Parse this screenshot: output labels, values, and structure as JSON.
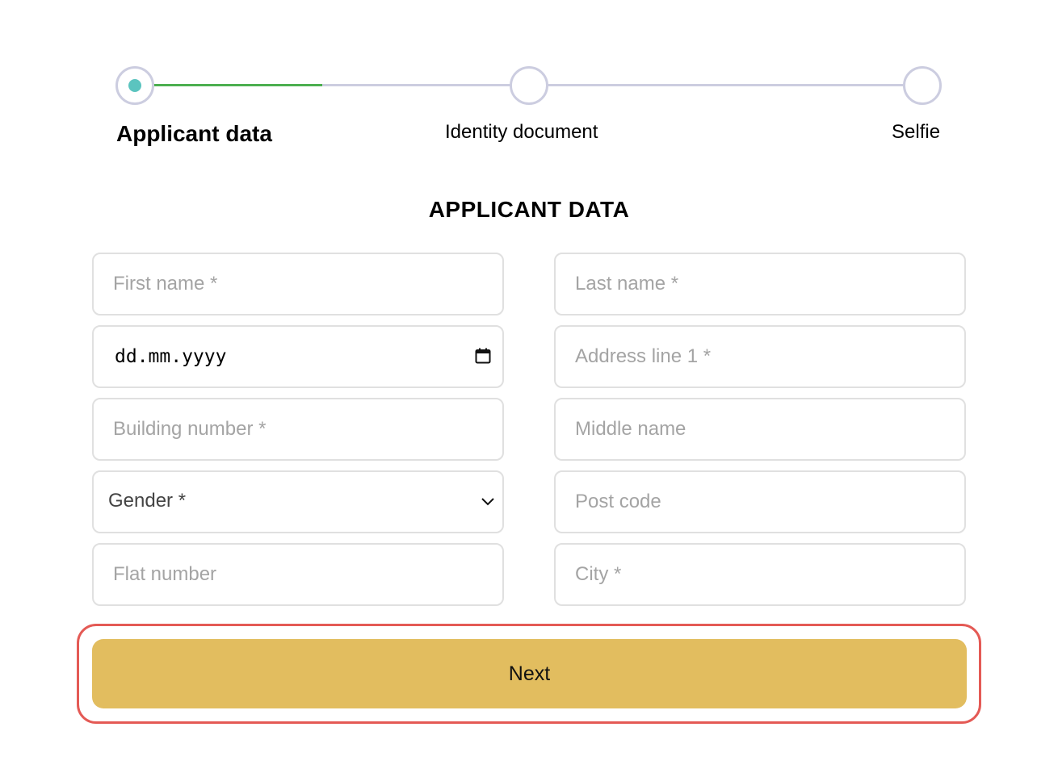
{
  "stepper": {
    "steps": [
      {
        "label": "Applicant data",
        "state": "active"
      },
      {
        "label": "Identity document",
        "state": "upcoming"
      },
      {
        "label": "Selfie",
        "state": "upcoming"
      }
    ],
    "colors": {
      "progress": "#4caf50",
      "track": "#cccde0",
      "active_dot": "#5bc4bf"
    }
  },
  "form": {
    "title": "APPLICANT DATA",
    "fields": {
      "first_name": {
        "placeholder": "First name *",
        "value": ""
      },
      "last_name": {
        "placeholder": "Last name *",
        "value": ""
      },
      "birth_date": {
        "display": "dd.mm.yyyy",
        "icon": "calendar-icon"
      },
      "address_line_1": {
        "placeholder": "Address line 1 *",
        "value": ""
      },
      "building_number": {
        "placeholder": "Building number *",
        "value": ""
      },
      "middle_name": {
        "placeholder": "Middle name",
        "value": ""
      },
      "gender": {
        "selected": "Gender *",
        "icon": "chevron-down-icon"
      },
      "post_code": {
        "placeholder": "Post code",
        "value": ""
      },
      "flat_number": {
        "placeholder": "Flat number",
        "value": ""
      },
      "city": {
        "placeholder": "City *",
        "value": ""
      }
    }
  },
  "actions": {
    "next_label": "Next",
    "next_color": "#e2bd5f",
    "focus_ring_color": "#e45a55"
  }
}
